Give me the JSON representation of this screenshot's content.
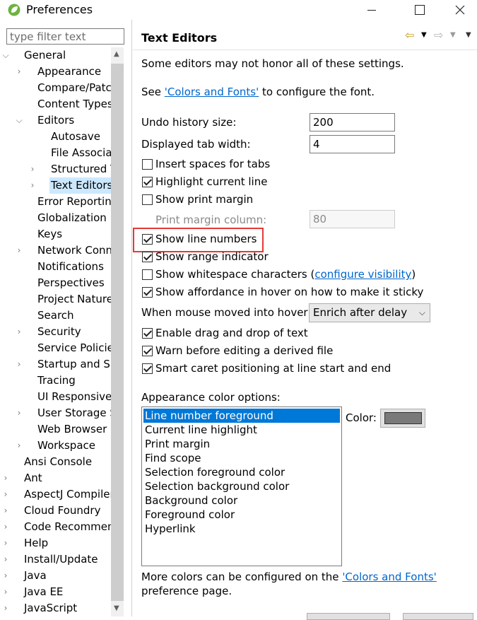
{
  "window": {
    "title": "Preferences"
  },
  "filter": {
    "placeholder": "type filter text"
  },
  "tree": [
    {
      "label": "General",
      "indent": 0,
      "expander": "expanded"
    },
    {
      "label": "Appearance",
      "indent": 1,
      "expander": "collapsed"
    },
    {
      "label": "Compare/Patch",
      "indent": 1,
      "expander": "none"
    },
    {
      "label": "Content Types",
      "indent": 1,
      "expander": "none"
    },
    {
      "label": "Editors",
      "indent": 1,
      "expander": "expanded"
    },
    {
      "label": "Autosave",
      "indent": 2,
      "expander": "none"
    },
    {
      "label": "File Associations",
      "indent": 2,
      "expander": "none"
    },
    {
      "label": "Structured Text Editors",
      "indent": 2,
      "expander": "collapsed"
    },
    {
      "label": "Text Editors",
      "indent": 2,
      "expander": "collapsed",
      "selected": true
    },
    {
      "label": "Error Reporting",
      "indent": 1,
      "expander": "none"
    },
    {
      "label": "Globalization",
      "indent": 1,
      "expander": "none"
    },
    {
      "label": "Keys",
      "indent": 1,
      "expander": "none"
    },
    {
      "label": "Network Connections",
      "indent": 1,
      "expander": "collapsed"
    },
    {
      "label": "Notifications",
      "indent": 1,
      "expander": "none"
    },
    {
      "label": "Perspectives",
      "indent": 1,
      "expander": "none"
    },
    {
      "label": "Project Natures",
      "indent": 1,
      "expander": "none"
    },
    {
      "label": "Search",
      "indent": 1,
      "expander": "none"
    },
    {
      "label": "Security",
      "indent": 1,
      "expander": "collapsed"
    },
    {
      "label": "Service Policies",
      "indent": 1,
      "expander": "none"
    },
    {
      "label": "Startup and Shutdown",
      "indent": 1,
      "expander": "collapsed"
    },
    {
      "label": "Tracing",
      "indent": 1,
      "expander": "none"
    },
    {
      "label": "UI Responsiveness",
      "indent": 1,
      "expander": "none"
    },
    {
      "label": "User Storage Service",
      "indent": 1,
      "expander": "collapsed"
    },
    {
      "label": "Web Browser",
      "indent": 1,
      "expander": "none"
    },
    {
      "label": "Workspace",
      "indent": 1,
      "expander": "collapsed"
    },
    {
      "label": "Ansi Console",
      "indent": 0,
      "expander": "none"
    },
    {
      "label": "Ant",
      "indent": 0,
      "expander": "collapsed"
    },
    {
      "label": "AspectJ Compiler",
      "indent": 0,
      "expander": "collapsed"
    },
    {
      "label": "Cloud Foundry",
      "indent": 0,
      "expander": "collapsed"
    },
    {
      "label": "Code Recommenders",
      "indent": 0,
      "expander": "collapsed"
    },
    {
      "label": "Help",
      "indent": 0,
      "expander": "collapsed"
    },
    {
      "label": "Install/Update",
      "indent": 0,
      "expander": "collapsed"
    },
    {
      "label": "Java",
      "indent": 0,
      "expander": "collapsed"
    },
    {
      "label": "Java EE",
      "indent": 0,
      "expander": "collapsed"
    },
    {
      "label": "JavaScript",
      "indent": 0,
      "expander": "collapsed"
    }
  ],
  "page": {
    "title": "Text Editors",
    "intro": "Some editors may not honor all of these settings.",
    "font_prefix": "See ",
    "font_link": "'Colors and Fonts'",
    "font_suffix": " to configure the font.",
    "undo_label": "Undo history size:",
    "undo_value": "200",
    "tab_label": "Displayed tab width:",
    "tab_value": "4",
    "insert_spaces": {
      "label": "Insert spaces for tabs",
      "checked": false
    },
    "highlight_line": {
      "label": "Highlight current line",
      "checked": true
    },
    "print_margin": {
      "label": "Show print margin",
      "checked": false
    },
    "print_margin_col_label": "Print margin column:",
    "print_margin_col_value": "80",
    "line_numbers": {
      "label": "Show line numbers",
      "checked": true
    },
    "range_indicator": {
      "label": "Show range indicator",
      "checked": true
    },
    "whitespace": {
      "label": "Show whitespace characters (",
      "link": "configure visibility",
      "suffix": ")",
      "checked": false
    },
    "affordance": {
      "label": "Show affordance in hover on how to make it sticky",
      "checked": true
    },
    "hover_label": "When mouse moved into hover:",
    "hover_value": "Enrich after delay",
    "drag_drop": {
      "label": "Enable drag and drop of text",
      "checked": true
    },
    "warn_derived": {
      "label": "Warn before editing a derived file",
      "checked": true
    },
    "smart_caret": {
      "label": "Smart caret positioning at line start and end",
      "checked": true
    },
    "appearance_label": "Appearance color options:",
    "color_options": [
      "Line number foreground",
      "Current line highlight",
      "Print margin",
      "Find scope",
      "Selection foreground color",
      "Selection background color",
      "Background color",
      "Foreground color",
      "Hyperlink"
    ],
    "color_selected_index": 0,
    "color_label": "Color:",
    "color_value": "#7a7a7a",
    "more_colors_prefix": "More colors can be configured on the ",
    "more_colors_link": "'Colors and Fonts'",
    "more_colors_suffix": "preference page."
  },
  "colors": {
    "selection": "#0078d7",
    "tree_selection": "#cce8ff",
    "link": "#0066cc",
    "highlight_box": "#e53935"
  }
}
